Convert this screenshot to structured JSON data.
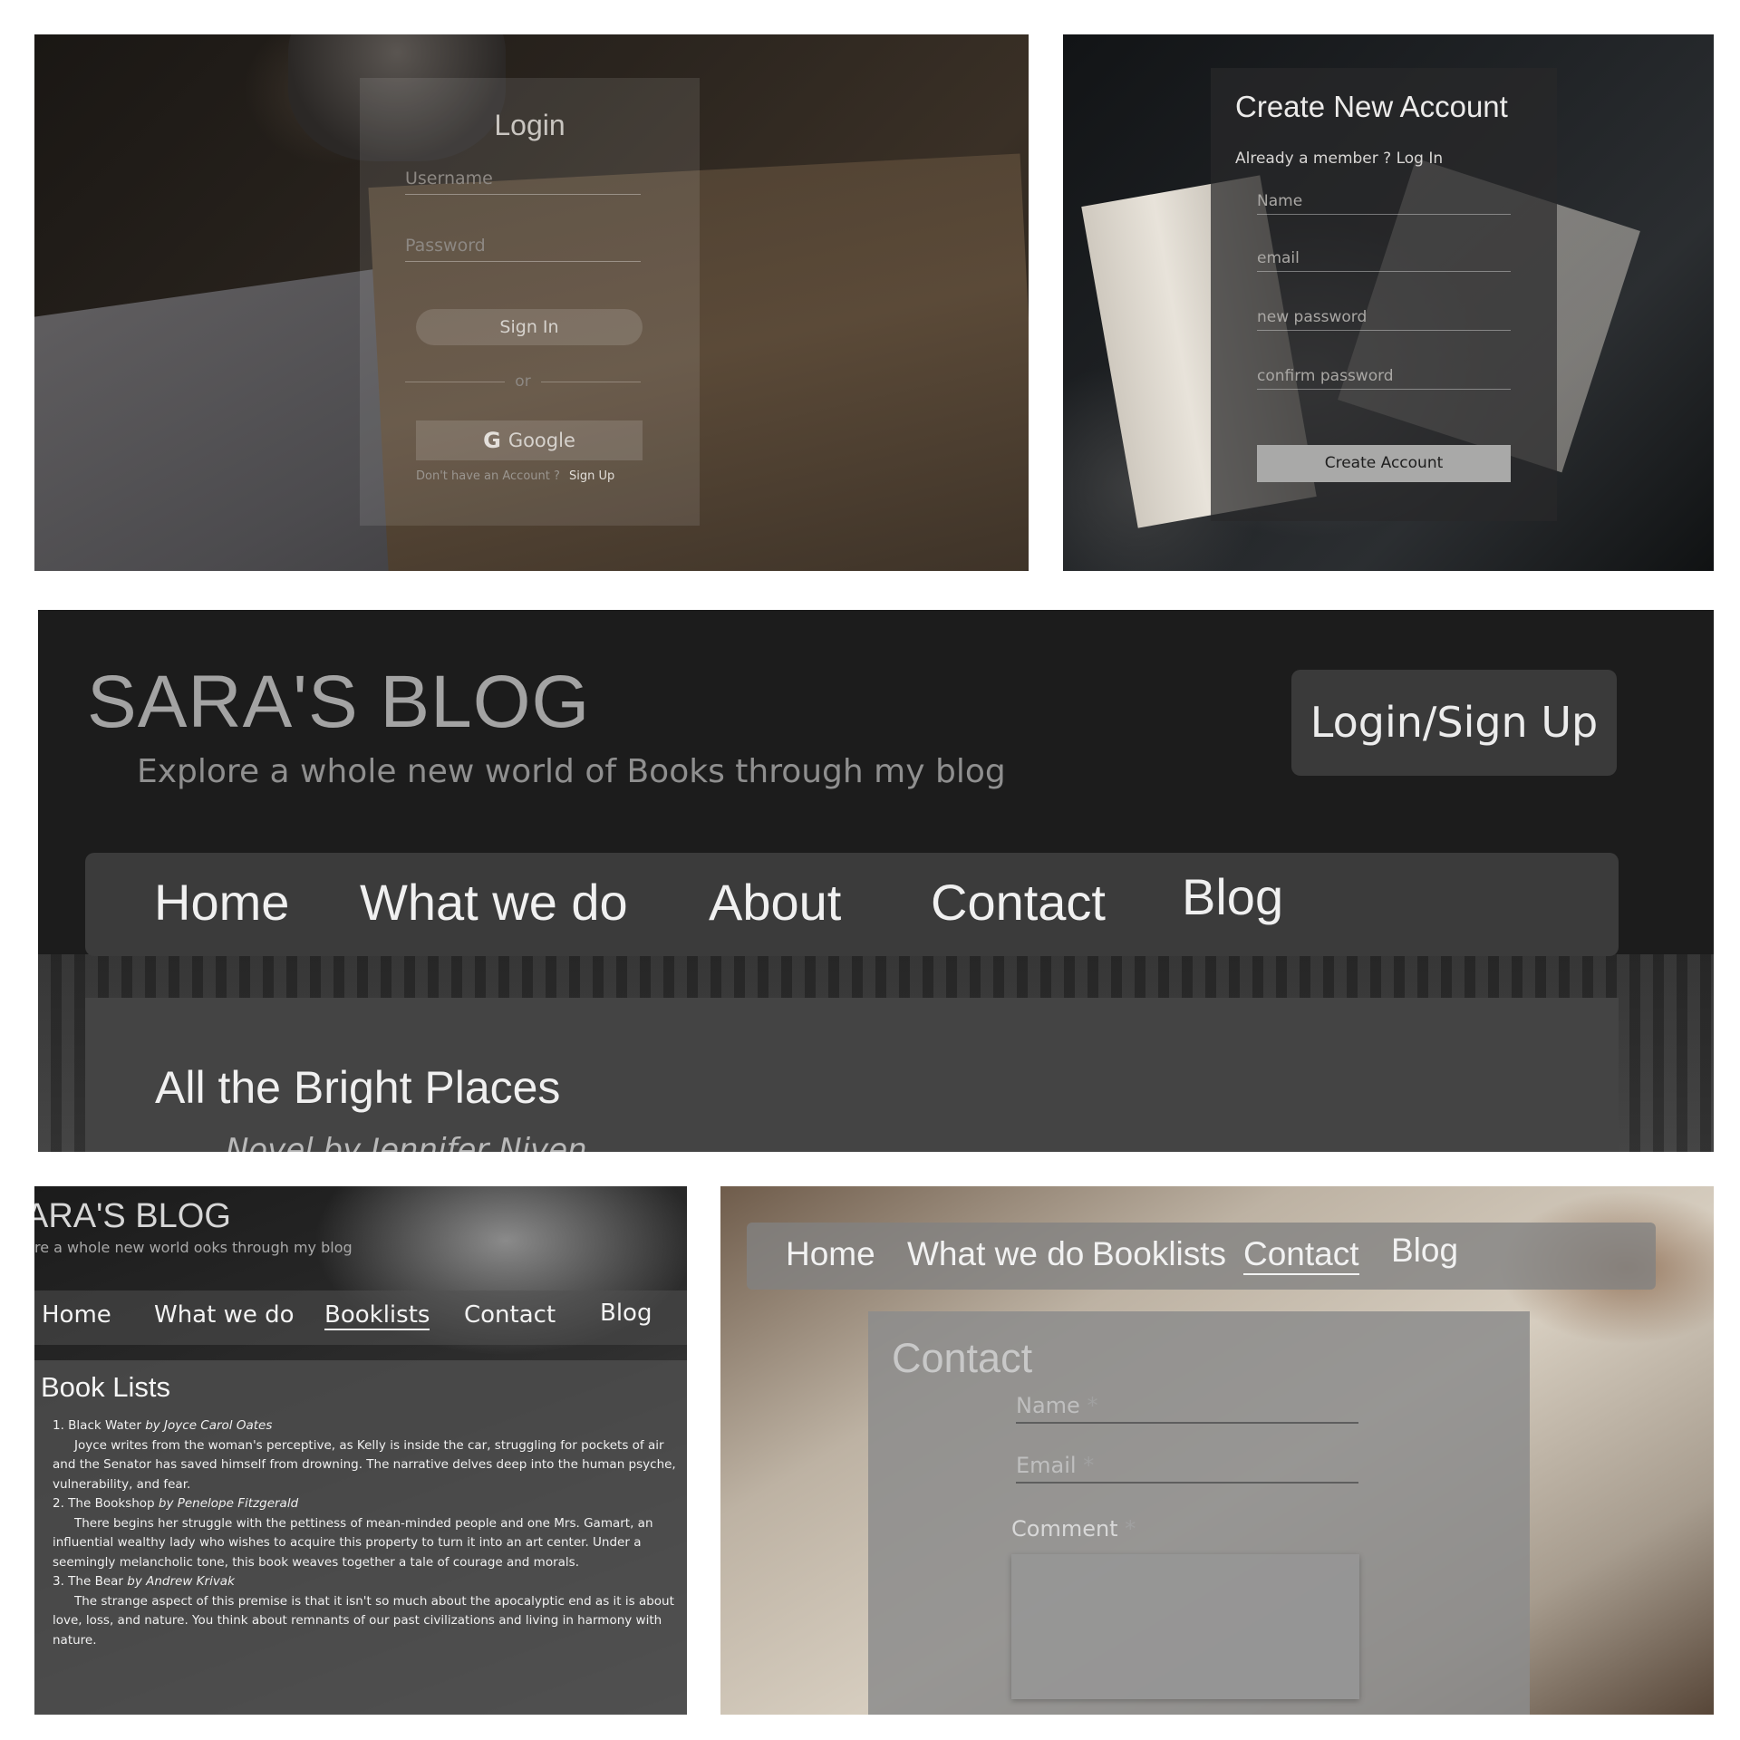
{
  "login": {
    "title": "Login",
    "username_placeholder": "Username",
    "password_placeholder": "Password",
    "sign_in_label": "Sign In",
    "or_label": "or",
    "google_icon": "G",
    "google_label": "Google",
    "no_account_text": "Don't have an Account ?",
    "sign_up_link": "Sign Up"
  },
  "create_account": {
    "title": "Create New Account",
    "already_member_text": "Already a member ? Log In",
    "name_placeholder": "Name",
    "email_placeholder": "email",
    "new_password_placeholder": "new password",
    "confirm_password_placeholder": "confirm password",
    "create_button": "Create Account"
  },
  "blog": {
    "site_title": "SARA'S BLOG",
    "tagline": "Explore a whole new world of Books through my blog",
    "login_signup_button": "Login/Sign Up",
    "nav": [
      "Home",
      "What we do",
      "About",
      "Contact",
      "Blog"
    ],
    "post_title": "All the Bright Places",
    "post_subtitle": "Novel by Jennifer Niven"
  },
  "booklists": {
    "site_title": "ARA'S BLOG",
    "tagline": "re a whole new world   ooks through my blog",
    "nav": [
      "Home",
      "What we do",
      "Booklists",
      "Contact",
      "Blog"
    ],
    "heading": "Book Lists",
    "items": [
      {
        "title": "1. Black Water",
        "author": "by Joyce Carol Oates",
        "desc": "Joyce writes from the woman's perceptive, as Kelly is inside the car, struggling for pockets of air and the Senator has saved himself from drowning. The narrative delves deep into the human psyche, vulnerability, and fear."
      },
      {
        "title": "2. The Bookshop",
        "author": "by Penelope Fitzgerald",
        "desc": "There begins her struggle with the pettiness of mean-minded people and one Mrs. Gamart, an influential wealthy lady who wishes to acquire this property to turn it into an art center. Under a seemingly melancholic tone, this book weaves together a tale of courage and morals."
      },
      {
        "title": "3. The Bear",
        "author": "by Andrew Krivak",
        "desc": "The strange aspect of this premise is that it isn't so much about the apocalyptic end as it is about love, loss, and nature. You think about remnants of our past civilizations and living in harmony with nature."
      }
    ]
  },
  "contact": {
    "nav": [
      "Home",
      "What we do",
      "Booklists",
      "Contact",
      "Blog"
    ],
    "title": "Contact",
    "name_label": "Name",
    "email_label": "Email",
    "comment_label": "Comment",
    "required_mark": "*"
  }
}
